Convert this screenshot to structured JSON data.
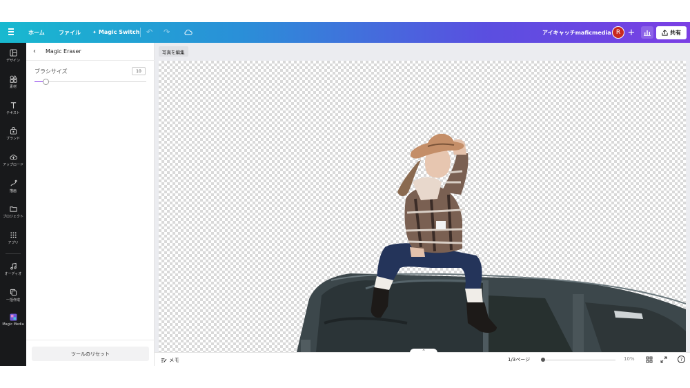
{
  "header": {
    "home_label": "ホーム",
    "file_label": "ファイル",
    "magic_switch_label": "Magic Switch",
    "doc_title": "アイキャッチmaficmedia",
    "avatar_initial": "R",
    "share_label": "共有"
  },
  "sidebar": {
    "items": [
      {
        "label": "デザイン",
        "icon": "layout-icon"
      },
      {
        "label": "素材",
        "icon": "shapes-icon"
      },
      {
        "label": "テキスト",
        "icon": "text-icon"
      },
      {
        "label": "ブランド",
        "icon": "brand-icon"
      },
      {
        "label": "アップロード",
        "icon": "upload-icon"
      },
      {
        "label": "描画",
        "icon": "draw-icon"
      },
      {
        "label": "プロジェクト",
        "icon": "folder-icon"
      },
      {
        "label": "アプリ",
        "icon": "apps-icon"
      },
      {
        "label": "オーディオ",
        "icon": "audio-icon"
      },
      {
        "label": "一括作成",
        "icon": "bulk-create-icon"
      },
      {
        "label": "Magic Media",
        "icon": "magic-media-icon"
      }
    ]
  },
  "panel": {
    "title": "Magic Eraser",
    "brush_size_label": "ブラシサイズ",
    "brush_size_value": "10",
    "brush_size_fraction": 0.1,
    "reset_label": "ツールのリセット"
  },
  "canvas": {
    "edit_photo_label": "写真を編集"
  },
  "footer": {
    "memo_label": "メモ",
    "page_indicator": "1/3ページ",
    "zoom_value": "10%",
    "zoom_fraction": 0.0,
    "expand_glyph": "⌃"
  },
  "colors": {
    "header_gradient_start": "#18b9cf",
    "header_gradient_end": "#7b3fe4",
    "rail_bg": "#18191b",
    "accent": "#7d2ae8",
    "avatar_bg": "#c8281e"
  }
}
